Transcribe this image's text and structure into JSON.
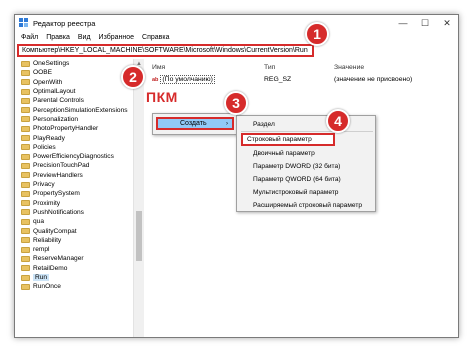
{
  "window": {
    "title": "Редактор реестра"
  },
  "window_controls": {
    "minimize": "—",
    "maximize": "☐",
    "close": "✕"
  },
  "menu": [
    "Файл",
    "Правка",
    "Вид",
    "Избранное",
    "Справка"
  ],
  "address": "Компьютер\\HKEY_LOCAL_MACHINE\\SOFTWARE\\Microsoft\\Windows\\CurrentVersion\\Run",
  "tree": {
    "items": [
      "OneSettings",
      "OOBE",
      "OpenWith",
      "OptimalLayout",
      "Parental Controls",
      "PerceptionSimulationExtensions",
      "Personalization",
      "PhotoPropertyHandler",
      "PlayReady",
      "Policies",
      "PowerEfficiencyDiagnostics",
      "PrecisionTouchPad",
      "PreviewHandlers",
      "Privacy",
      "PropertySystem",
      "Proximity",
      "PushNotifications",
      "qua",
      "QualityCompat",
      "Reliability",
      "rempl",
      "ReserveManager",
      "RetailDemo",
      "Run",
      "RunOnce"
    ],
    "selected": "Run"
  },
  "columns": {
    "name": "Имя",
    "type": "Тип",
    "value": "Значение"
  },
  "values": [
    {
      "icon": "ab",
      "name": "(По умолчанию)",
      "type": "REG_SZ",
      "data": "(значение не присвоено)"
    }
  ],
  "annotation": {
    "pkm": "ПКМ"
  },
  "steps": [
    "1",
    "2",
    "3",
    "4"
  ],
  "context_menu": {
    "create": "Создать",
    "arrow": "›"
  },
  "submenu": [
    "Раздел",
    "Строковый параметр",
    "Двоичный параметр",
    "Параметр DWORD (32 бита)",
    "Параметр QWORD (64 бита)",
    "Мультистроковый параметр",
    "Расширяемый строковый параметр"
  ],
  "colors": {
    "accent_red": "#d62b2b",
    "selection_blue": "#91c9f7",
    "folder_yellow": "#e8c262"
  }
}
